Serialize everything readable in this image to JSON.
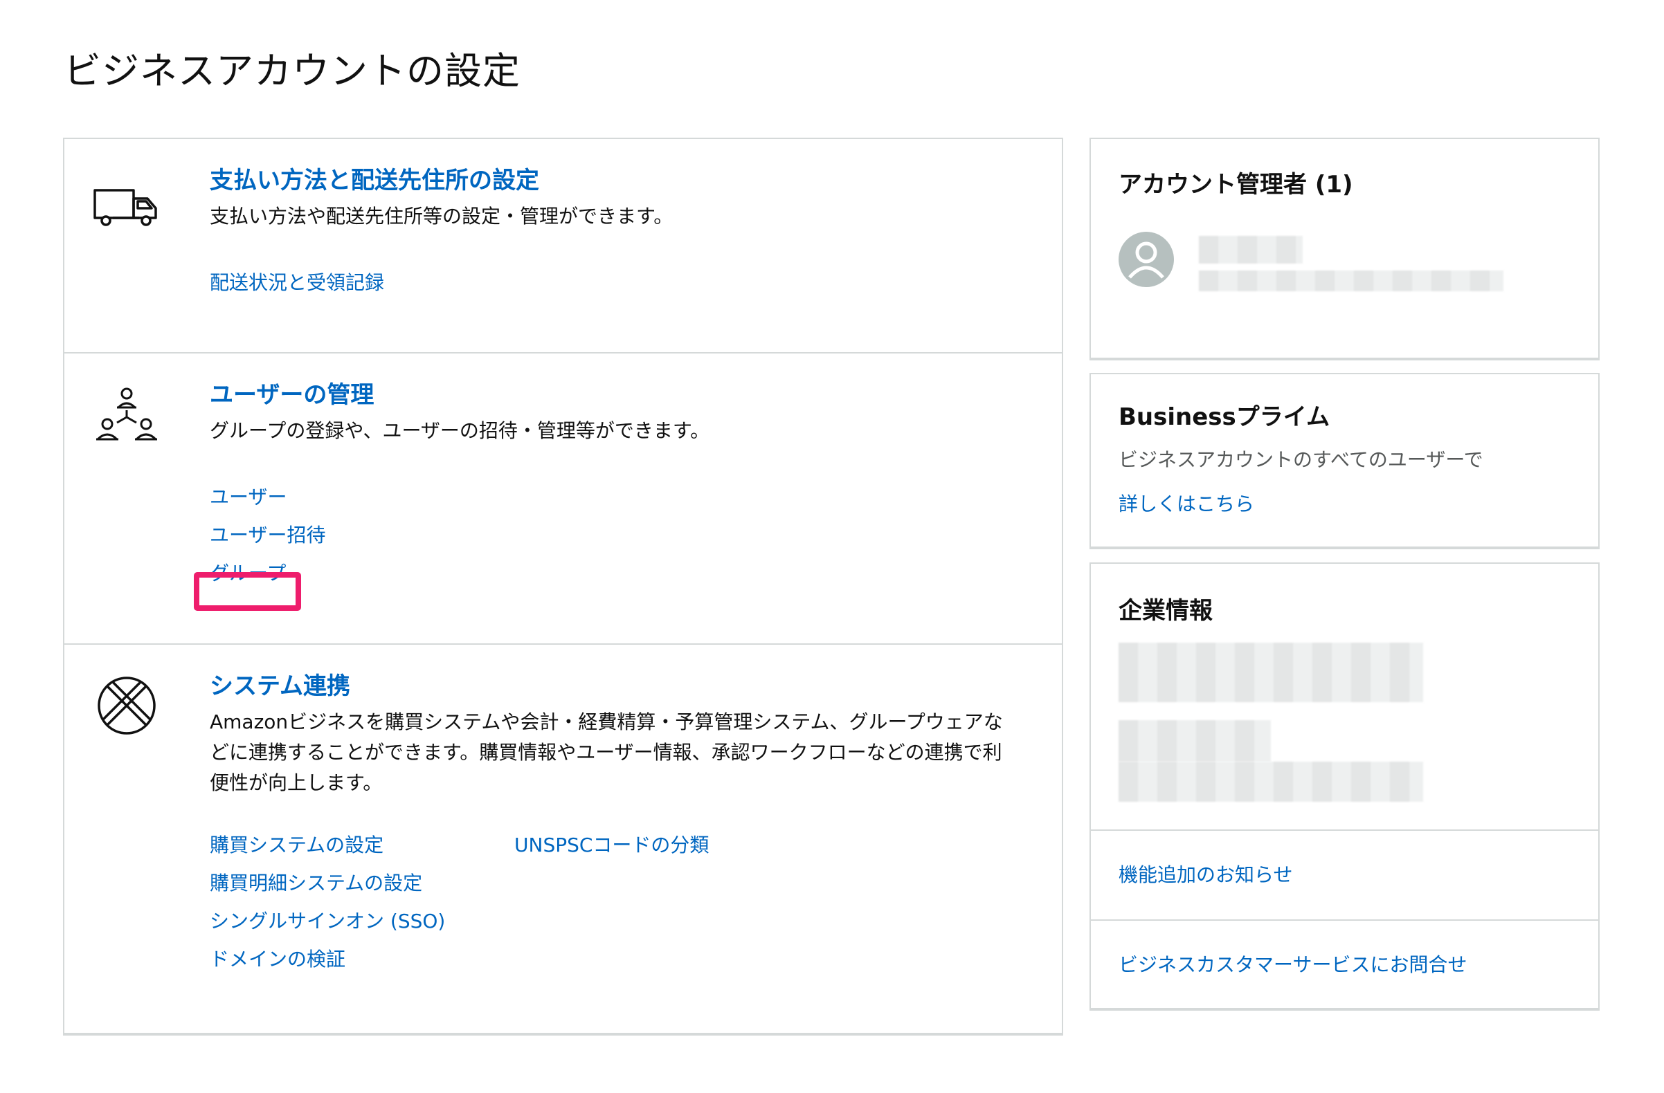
{
  "page": {
    "title": "ビジネスアカウントの設定"
  },
  "sections": [
    {
      "title": "支払い方法と配送先住所の設定",
      "description": "支払い方法や配送先住所等の設定・管理ができます。",
      "icon": "truck-icon",
      "links": [
        "配送状況と受領記録"
      ]
    },
    {
      "title": "ユーザーの管理",
      "description": "グループの登録や、ユーザーの招待・管理等ができます。",
      "icon": "users-network-icon",
      "links": [
        "ユーザー",
        "ユーザー招待",
        "グループ"
      ]
    },
    {
      "title": "システム連携",
      "description": "Amazonビジネスを購買システムや会計・経費精算・予算管理システム、グループウェアなどに連携することができます。購買情報やユーザー情報、承認ワークフローなどの連携で利便性が向上します。",
      "icon": "system-integration-icon",
      "links_col1": [
        "購買システムの設定",
        "購買明細システムの設定",
        "シングルサインオン (SSO)",
        "ドメインの検証"
      ],
      "links_col2": [
        "UNSPSCコードの分類"
      ]
    }
  ],
  "sidebar": {
    "admins": {
      "title": "アカウント管理者 (1)",
      "icon": "user-avatar-icon"
    },
    "prime": {
      "title": "Businessプライム",
      "description": "ビジネスアカウントのすべてのユーザーで",
      "link": "詳しくはこちら"
    },
    "company": {
      "title": "企業情報",
      "link_features": "機能追加のお知らせ",
      "link_support": "ビジネスカスタマーサービスにお問合せ"
    }
  },
  "colors": {
    "link": "#0066c0",
    "border": "#d5d9d9",
    "highlight": "#ee1d6c",
    "avatar": "#b6c0bf"
  }
}
